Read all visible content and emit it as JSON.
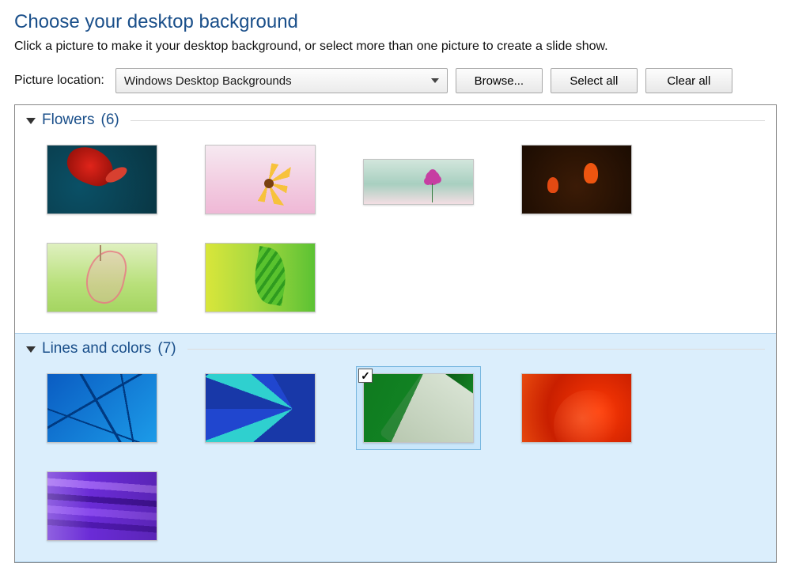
{
  "title": "Choose your desktop background",
  "subtitle": "Click a picture to make it your desktop background, or select more than one picture to create a slide show.",
  "controls": {
    "location_label": "Picture location:",
    "location_value": "Windows Desktop Backgrounds",
    "browse": "Browse...",
    "select_all": "Select all",
    "clear_all": "Clear all"
  },
  "groups": [
    {
      "name": "Flowers",
      "count": "(6)",
      "selected": false,
      "items": [
        {
          "id": "flower-red-teal",
          "css": "f1",
          "checked": false
        },
        {
          "id": "flower-yellow-pink",
          "css": "f2",
          "checked": false
        },
        {
          "id": "flower-pink-small",
          "css": "f3",
          "checked": false,
          "narrow": true
        },
        {
          "id": "flower-orange-dark",
          "css": "f4",
          "checked": false
        },
        {
          "id": "flower-pink-green",
          "css": "f5",
          "checked": false
        },
        {
          "id": "flower-fern-green",
          "css": "f6",
          "checked": false
        }
      ]
    },
    {
      "name": "Lines and colors",
      "count": "(7)",
      "selected": true,
      "items": [
        {
          "id": "lines-blue",
          "css": "c1",
          "checked": false
        },
        {
          "id": "lines-balloon",
          "css": "c2",
          "checked": false
        },
        {
          "id": "lines-green",
          "css": "c3",
          "checked": true
        },
        {
          "id": "lines-orange",
          "css": "c4",
          "checked": false
        },
        {
          "id": "lines-purple",
          "css": "c5",
          "checked": false
        }
      ]
    }
  ],
  "checkmark": "✓"
}
